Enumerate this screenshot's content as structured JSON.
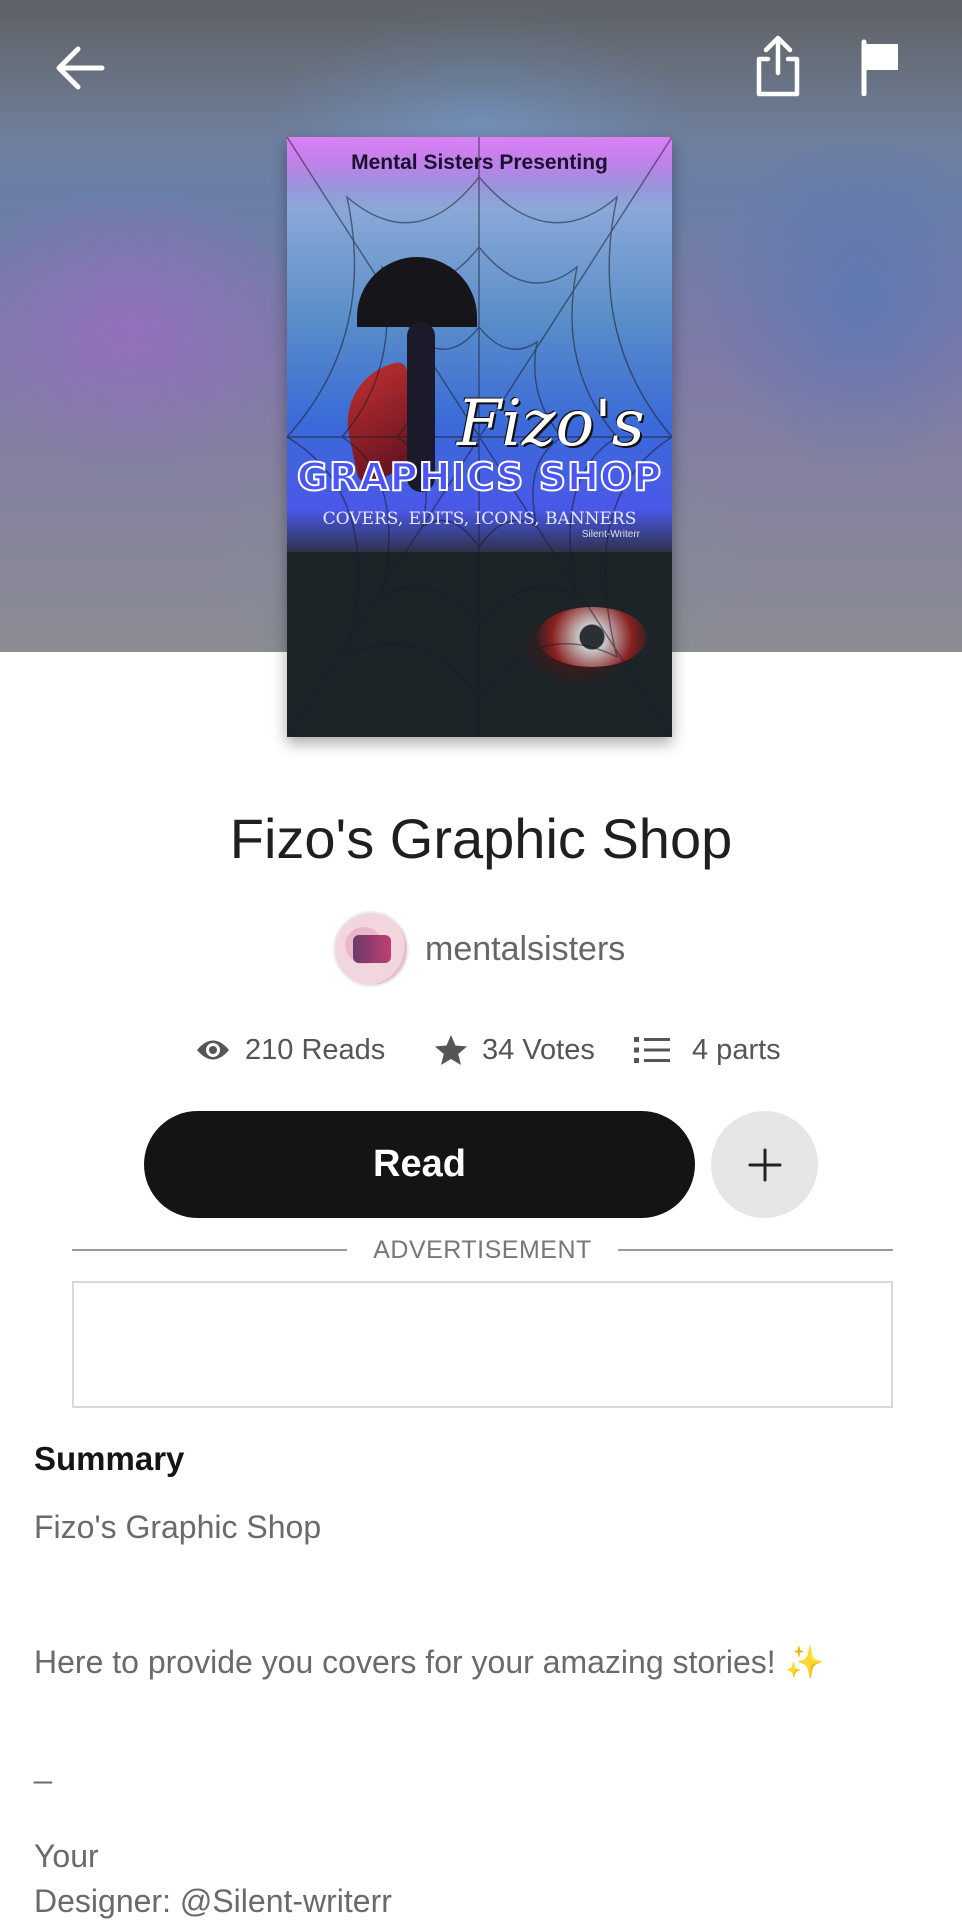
{
  "header": {
    "back_icon": "arrow-left-icon",
    "share_icon": "share-icon",
    "flag_icon": "flag-icon"
  },
  "cover": {
    "kicker": "Mental Sisters Presenting",
    "title_script": "Fizo's",
    "title_block": "GRAPHICS SHOP",
    "subtitle": "COVERS, EDITS, ICONS, BANNERS",
    "credit": "Silent-Writerr"
  },
  "story": {
    "title": "Fizo's Graphic Shop",
    "author": "mentalsisters"
  },
  "stats": {
    "reads": "210 Reads",
    "votes": "34 Votes",
    "parts": "4 parts"
  },
  "actions": {
    "read_label": "Read",
    "add_icon": "plus-icon"
  },
  "ad": {
    "label": "ADVERTISEMENT"
  },
  "summary": {
    "heading": "Summary",
    "line1": "Fizo's Graphic Shop",
    "line2": "Here to provide you covers for your amazing stories! ✨",
    "line3": "_",
    "line4": "Your",
    "line5": "Designer: @Silent-writerr"
  },
  "colors": {
    "read_button": "#141414",
    "add_button": "#e6e6e6",
    "title_text": "#1f1f1f",
    "muted_text": "#6a6a6a"
  }
}
